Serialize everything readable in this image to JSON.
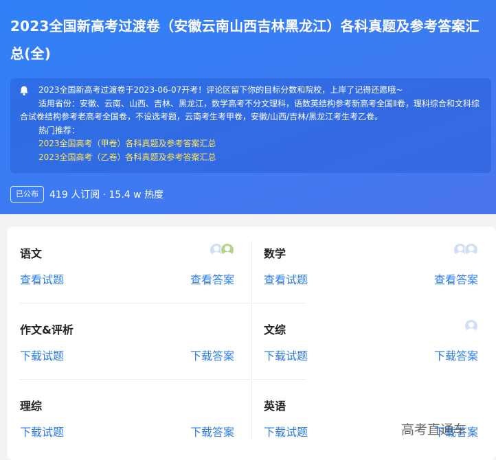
{
  "hero": {
    "title": "2023全国新高考过渡卷（安徽云南山西吉林黑龙江）各科真题及参考答案汇总(全)",
    "notice": {
      "line1": "2023全国新高考过渡卷于2023-06-07开考！评论区留下你的目标分数和院校，上岸了记得还愿哦~",
      "line2": "适用省份：安徽、云南、山西、吉林、黑龙江，数学高考不分文理科，语数英结构参考新高考全国Ⅱ卷，理科综合和文科综合试卷结构参考老高考全国卷，不设选考题，云南考生考甲卷，安徽/山西/吉林/黑龙江考生考乙卷。",
      "hot_label": "热门推荐：",
      "rec1": "2023全国高考（甲卷）各科真题及参考答案汇总",
      "rec2": "2023全国高考（乙卷）各科真题及参考答案汇总"
    },
    "badge": "已公布",
    "stats": "419 人订阅 · 15.4 w 热度"
  },
  "subjects": [
    {
      "name": "语文",
      "left": "查看试题",
      "right": "查看答案"
    },
    {
      "name": "数学",
      "left": "查看试题",
      "right": "查看答案"
    },
    {
      "name": "作文&评析",
      "left": "下载试题",
      "right": "下载答案"
    },
    {
      "name": "文综",
      "left": "下载试题",
      "right": "下载答案"
    },
    {
      "name": "理综",
      "left": "下载试题",
      "right": "下载答案"
    },
    {
      "name": "英语",
      "left": "下载试题",
      "right": "下载答案"
    }
  ],
  "watermark": "高考直通车",
  "colors": {
    "accent": "#2b7de9",
    "hero": "#3b7cf3",
    "highlight": "#ffe65a"
  }
}
